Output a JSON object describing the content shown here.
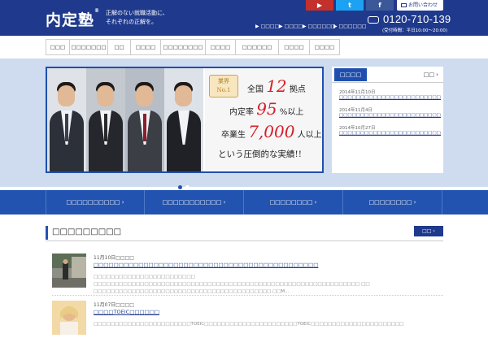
{
  "header": {
    "logo": "内定塾",
    "logo_mark": "®",
    "tagline_1": "正解のない就職活動に、",
    "tagline_2": "それぞれの正解を。",
    "contact_label": "お問い合わせ",
    "nav": [
      "▶ □□□□",
      "▶ □□□□",
      "▶ □□□□□□",
      "▶ □□□□□□"
    ],
    "phone": "0120-710-139",
    "hours": "(受付時間：平日10:00～20:00)",
    "social": [
      "youtube-icon",
      "twitter-icon",
      "facebook-icon"
    ]
  },
  "gnav": [
    "□□□",
    "□□□□□□□",
    "□□",
    "□□□□",
    "□□□□□□□□",
    "□□□□",
    "□□□□□□",
    "□□□□",
    "□□□□"
  ],
  "hero": {
    "badge_1": "業界",
    "badge_2": "No.1",
    "line1_pre": "全国",
    "line1_num": "12",
    "line1_post": "拠点",
    "line2_pre": "内定率",
    "line2_num": "95",
    "line2_post": "%以上",
    "line3_pre": "卒業生",
    "line3_num": "7,000",
    "line3_post": "人以上",
    "line4": "という圧倒的な実績!!"
  },
  "news": {
    "title": "□□□□",
    "more": "□□ ›",
    "items": [
      {
        "date": "2014年11月10日",
        "link": "□□□□□□□□□□□□□□□□□□□□□□□□□□□□vol.5"
      },
      {
        "date": "2014年11月4日",
        "link": "□□□□□□□□□□□□□□□□□□□□□□□□□□□□vol.4"
      },
      {
        "date": "2014年10月27日",
        "link": "□□□□□□□□□□□□□□□□□□□□□□□□□□□□vol.3"
      }
    ]
  },
  "categories": [
    "□□□□□□□□□□ ›",
    "□□□□□□□□□□□ ›",
    "□□□□□□□□ ›",
    "□□□□□□□□ ›"
  ],
  "section": {
    "title": "□□□□□□□□□",
    "more": "□□ ›"
  },
  "articles": [
    {
      "date": "11月10日□□□□",
      "title": "□□□□□□□□□□□□□□□□□□□□□□□□□□□□□□□□□□□□□□□□□□□□□",
      "body": "□□□□□□□□□□□□□□□□□□□□□□□□ □□□□□□□□□□□□□□□□□□□□□□□□□□□□□□□□□□□□□□□□□□□□□□□□□□□□□□□□□□□□□□□ □□ □□□□□□□□□□□□□□□□□□□□□□□□□□□□□□□□□□□□□□□□□□ □□M..."
    },
    {
      "date": "11月07日□□□□",
      "title": "□□□□TOEIC□□□□□□",
      "body": "□□□□□□□□□□□□□□□□□□□□□□□TOEIC□□□□□□□□□□□□□□□□□□□□□□TOEIC□□□□□□□□□□□□□□□□□□□□□□"
    }
  ],
  "colors": {
    "header_bg": "#1f3a8c",
    "hero_bg": "#cfdcef",
    "accent_blue": "#2253b0",
    "highlight_red": "#d41f2b"
  }
}
